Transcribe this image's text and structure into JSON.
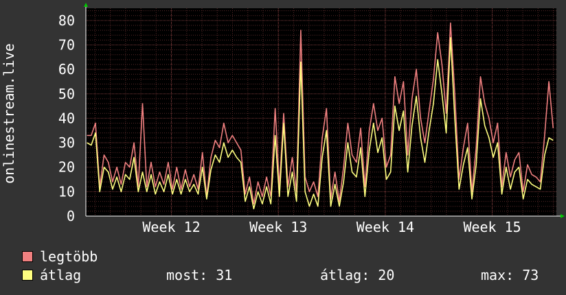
{
  "chart_data": {
    "type": "line",
    "ylabel": "onlinestream.live",
    "xlabel": "",
    "ylim": [
      0,
      85
    ],
    "yticks": [
      0,
      10,
      20,
      30,
      40,
      50,
      60,
      70,
      80
    ],
    "xticks": [
      {
        "label": "Week 12",
        "pos": 12
      },
      {
        "label": "Week 13",
        "pos": 13
      },
      {
        "label": "Week 14",
        "pos": 14
      },
      {
        "label": "Week 15",
        "pos": 15
      }
    ],
    "xlim": [
      11.2,
      15.6
    ],
    "grid": true,
    "background": "#000000",
    "series": [
      {
        "name": "legtöbb",
        "color": "#f08080",
        "points": [
          [
            11.21,
            33
          ],
          [
            11.25,
            33
          ],
          [
            11.29,
            38
          ],
          [
            11.33,
            12
          ],
          [
            11.37,
            25
          ],
          [
            11.41,
            22
          ],
          [
            11.45,
            14
          ],
          [
            11.49,
            20
          ],
          [
            11.53,
            13
          ],
          [
            11.57,
            22
          ],
          [
            11.61,
            20
          ],
          [
            11.65,
            30
          ],
          [
            11.69,
            12
          ],
          [
            11.73,
            46
          ],
          [
            11.77,
            12
          ],
          [
            11.81,
            22
          ],
          [
            11.85,
            12
          ],
          [
            11.89,
            18
          ],
          [
            11.93,
            13
          ],
          [
            11.97,
            22
          ],
          [
            12.01,
            11
          ],
          [
            12.05,
            20
          ],
          [
            12.09,
            11
          ],
          [
            12.13,
            19
          ],
          [
            12.17,
            12
          ],
          [
            12.21,
            17
          ],
          [
            12.25,
            11
          ],
          [
            12.29,
            26
          ],
          [
            12.33,
            8
          ],
          [
            12.37,
            24
          ],
          [
            12.41,
            31
          ],
          [
            12.45,
            28
          ],
          [
            12.49,
            38
          ],
          [
            12.53,
            30
          ],
          [
            12.57,
            33
          ],
          [
            12.61,
            30
          ],
          [
            12.65,
            27
          ],
          [
            12.69,
            9
          ],
          [
            12.73,
            16
          ],
          [
            12.77,
            5
          ],
          [
            12.81,
            14
          ],
          [
            12.85,
            8
          ],
          [
            12.89,
            16
          ],
          [
            12.93,
            8
          ],
          [
            12.97,
            44
          ],
          [
            13.01,
            12
          ],
          [
            13.05,
            42
          ],
          [
            13.09,
            12
          ],
          [
            13.13,
            24
          ],
          [
            13.17,
            10
          ],
          [
            13.21,
            76
          ],
          [
            13.25,
            16
          ],
          [
            13.29,
            10
          ],
          [
            13.33,
            14
          ],
          [
            13.37,
            8
          ],
          [
            13.41,
            32
          ],
          [
            13.45,
            44
          ],
          [
            13.49,
            7
          ],
          [
            13.53,
            18
          ],
          [
            13.57,
            6
          ],
          [
            13.61,
            20
          ],
          [
            13.65,
            38
          ],
          [
            13.69,
            25
          ],
          [
            13.73,
            22
          ],
          [
            13.77,
            36
          ],
          [
            13.81,
            12
          ],
          [
            13.85,
            35
          ],
          [
            13.89,
            46
          ],
          [
            13.93,
            35
          ],
          [
            13.97,
            40
          ],
          [
            14.01,
            20
          ],
          [
            14.05,
            25
          ],
          [
            14.09,
            57
          ],
          [
            14.13,
            46
          ],
          [
            14.17,
            55
          ],
          [
            14.21,
            25
          ],
          [
            14.25,
            48
          ],
          [
            14.29,
            60
          ],
          [
            14.33,
            40
          ],
          [
            14.37,
            30
          ],
          [
            14.41,
            43
          ],
          [
            14.45,
            56
          ],
          [
            14.49,
            75
          ],
          [
            14.53,
            62
          ],
          [
            14.57,
            42
          ],
          [
            14.61,
            79
          ],
          [
            14.65,
            50
          ],
          [
            14.69,
            15
          ],
          [
            14.73,
            28
          ],
          [
            14.77,
            38
          ],
          [
            14.81,
            10
          ],
          [
            14.85,
            28
          ],
          [
            14.89,
            57
          ],
          [
            14.93,
            46
          ],
          [
            14.97,
            40
          ],
          [
            15.01,
            30
          ],
          [
            15.05,
            38
          ],
          [
            15.09,
            12
          ],
          [
            15.13,
            26
          ],
          [
            15.17,
            16
          ],
          [
            15.21,
            23
          ],
          [
            15.25,
            26
          ],
          [
            15.29,
            10
          ],
          [
            15.33,
            21
          ],
          [
            15.37,
            17
          ],
          [
            15.41,
            16
          ],
          [
            15.45,
            14
          ],
          [
            15.49,
            33
          ],
          [
            15.53,
            55
          ],
          [
            15.57,
            36
          ]
        ]
      },
      {
        "name": "átlag",
        "color": "#ffff80",
        "points": [
          [
            11.21,
            30
          ],
          [
            11.25,
            29
          ],
          [
            11.29,
            34
          ],
          [
            11.33,
            10
          ],
          [
            11.37,
            20
          ],
          [
            11.41,
            18
          ],
          [
            11.45,
            11
          ],
          [
            11.49,
            16
          ],
          [
            11.53,
            10
          ],
          [
            11.57,
            17
          ],
          [
            11.61,
            15
          ],
          [
            11.65,
            24
          ],
          [
            11.69,
            10
          ],
          [
            11.73,
            18
          ],
          [
            11.77,
            10
          ],
          [
            11.81,
            17
          ],
          [
            11.85,
            9
          ],
          [
            11.89,
            14
          ],
          [
            11.93,
            10
          ],
          [
            11.97,
            17
          ],
          [
            12.01,
            9
          ],
          [
            12.05,
            15
          ],
          [
            12.09,
            9
          ],
          [
            12.13,
            15
          ],
          [
            12.17,
            10
          ],
          [
            12.21,
            13
          ],
          [
            12.25,
            9
          ],
          [
            12.29,
            20
          ],
          [
            12.33,
            7
          ],
          [
            12.37,
            19
          ],
          [
            12.41,
            25
          ],
          [
            12.45,
            22
          ],
          [
            12.49,
            30
          ],
          [
            12.53,
            24
          ],
          [
            12.57,
            27
          ],
          [
            12.61,
            24
          ],
          [
            12.65,
            22
          ],
          [
            12.69,
            6
          ],
          [
            12.73,
            12
          ],
          [
            12.77,
            3
          ],
          [
            12.81,
            10
          ],
          [
            12.85,
            5
          ],
          [
            12.89,
            12
          ],
          [
            12.93,
            5
          ],
          [
            12.97,
            33
          ],
          [
            13.01,
            8
          ],
          [
            13.05,
            38
          ],
          [
            13.09,
            8
          ],
          [
            13.13,
            18
          ],
          [
            13.17,
            6
          ],
          [
            13.21,
            63
          ],
          [
            13.25,
            10
          ],
          [
            13.29,
            4
          ],
          [
            13.33,
            9
          ],
          [
            13.37,
            4
          ],
          [
            13.41,
            24
          ],
          [
            13.45,
            35
          ],
          [
            13.49,
            4
          ],
          [
            13.53,
            13
          ],
          [
            13.57,
            4
          ],
          [
            13.61,
            14
          ],
          [
            13.65,
            30
          ],
          [
            13.69,
            18
          ],
          [
            13.73,
            16
          ],
          [
            13.77,
            28
          ],
          [
            13.81,
            8
          ],
          [
            13.85,
            27
          ],
          [
            13.89,
            38
          ],
          [
            13.93,
            26
          ],
          [
            13.97,
            32
          ],
          [
            14.01,
            15
          ],
          [
            14.05,
            18
          ],
          [
            14.09,
            45
          ],
          [
            14.13,
            35
          ],
          [
            14.17,
            43
          ],
          [
            14.21,
            18
          ],
          [
            14.25,
            37
          ],
          [
            14.29,
            49
          ],
          [
            14.33,
            32
          ],
          [
            14.37,
            22
          ],
          [
            14.41,
            35
          ],
          [
            14.45,
            46
          ],
          [
            14.49,
            64
          ],
          [
            14.53,
            50
          ],
          [
            14.57,
            34
          ],
          [
            14.61,
            73
          ],
          [
            14.65,
            40
          ],
          [
            14.69,
            11
          ],
          [
            14.73,
            21
          ],
          [
            14.77,
            28
          ],
          [
            14.81,
            7
          ],
          [
            14.85,
            21
          ],
          [
            14.89,
            48
          ],
          [
            14.93,
            37
          ],
          [
            14.97,
            32
          ],
          [
            15.01,
            24
          ],
          [
            15.05,
            30
          ],
          [
            15.09,
            9
          ],
          [
            15.13,
            20
          ],
          [
            15.17,
            11
          ],
          [
            15.21,
            18
          ],
          [
            15.25,
            20
          ],
          [
            15.29,
            7
          ],
          [
            15.33,
            15
          ],
          [
            15.37,
            13
          ],
          [
            15.41,
            12
          ],
          [
            15.45,
            11
          ],
          [
            15.49,
            25
          ],
          [
            15.53,
            32
          ],
          [
            15.57,
            31
          ]
        ]
      }
    ]
  },
  "legend": [
    {
      "label": "legtöbb",
      "color": "#f08080"
    },
    {
      "label": "átlag",
      "color": "#ffff80"
    }
  ],
  "stats": {
    "most": "most: 31",
    "atlag": "átlag: 20",
    "max": "max: 73"
  }
}
